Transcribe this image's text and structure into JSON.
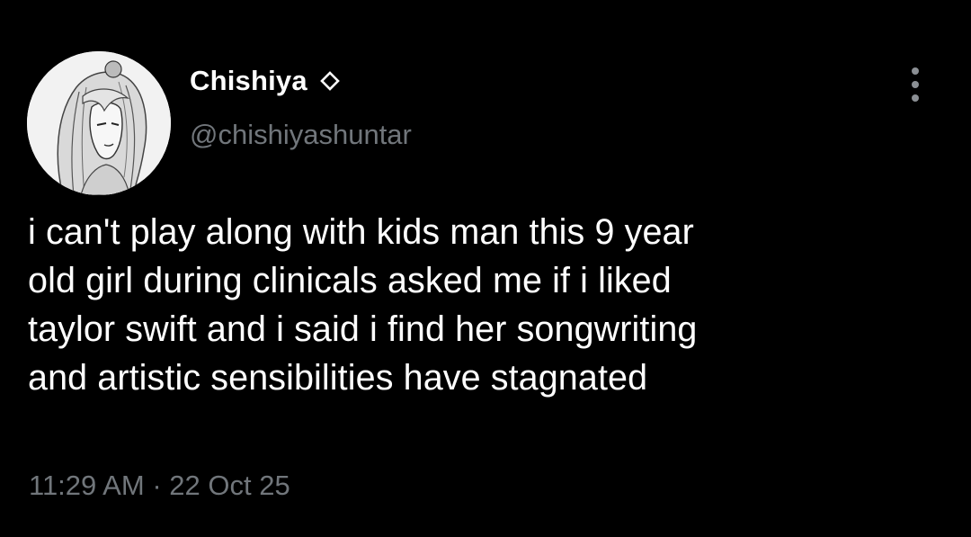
{
  "tweet": {
    "display_name": "Chishiya",
    "handle": "@chishiyashuntar",
    "avatar": "anime-style-portrait-avatar",
    "badge_icon": "diamond-outline-icon",
    "more_icon": "vertical-ellipsis-icon",
    "text": "i can't play along with kids man this 9 year\nold girl during clinicals asked me if i liked\ntaylor swift and i said i find her songwriting\nand artistic sensibilities have stagnated",
    "time": "11:29 AM",
    "separator": "·",
    "date": "22 Oct 25"
  },
  "colors": {
    "background": "#000000",
    "primary_text": "#ffffff",
    "secondary_text": "#71767b"
  }
}
